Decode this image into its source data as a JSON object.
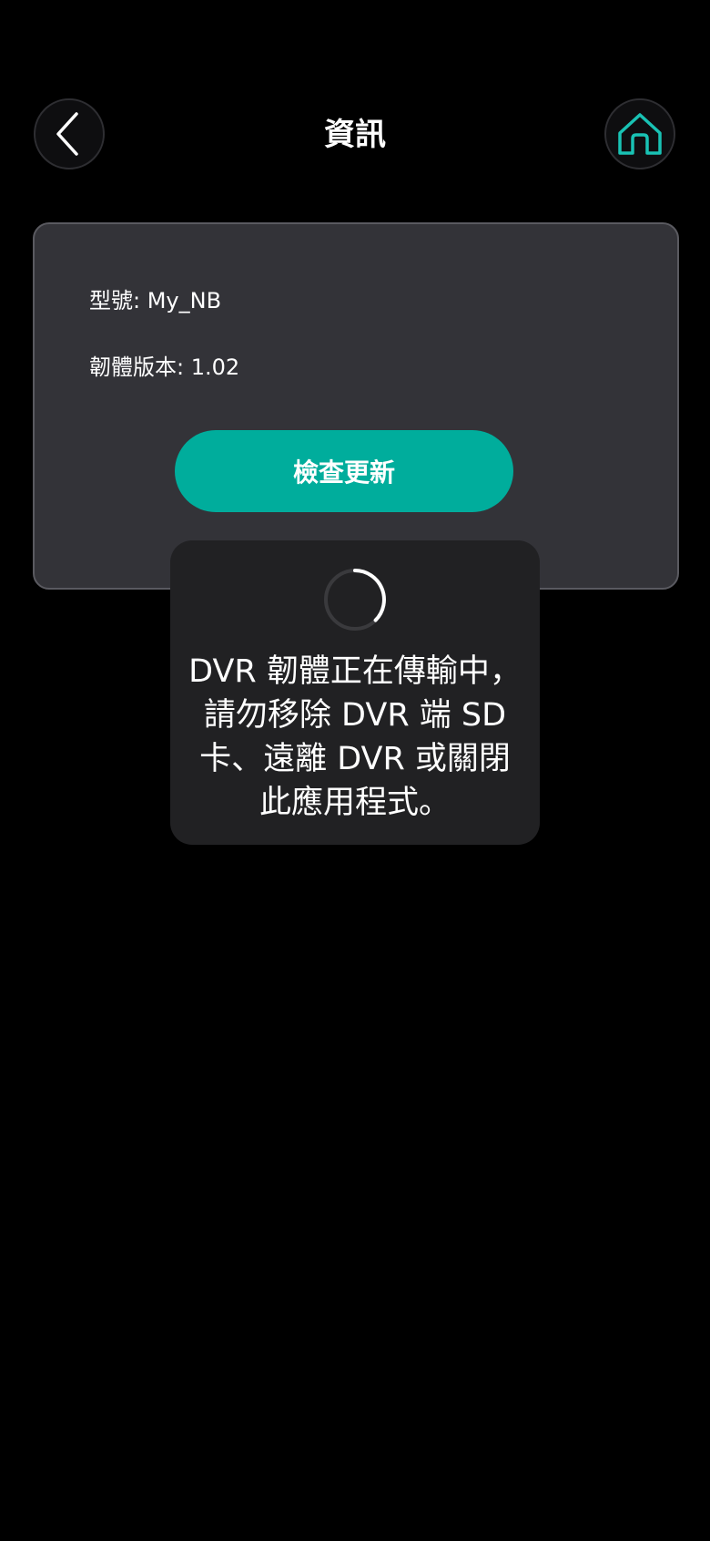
{
  "header": {
    "title": "資訊",
    "back_icon": "chevron-left-icon",
    "home_icon": "home-icon"
  },
  "info": {
    "model": "型號: My_NB",
    "firmware": "韌體版本: 1.02",
    "check_update_label": "檢查更新"
  },
  "toast": {
    "spinner_icon": "loading-spinner-icon",
    "message": "DVR 韌體正在傳輸中，請勿移除 DVR 端 SD 卡、遠離 DVR 或關閉此應用程式。"
  },
  "colors": {
    "background": "#000000",
    "card": "#333338",
    "accent": "#00ad9c",
    "home_icon": "#19c2b4",
    "toast": "#212123"
  }
}
